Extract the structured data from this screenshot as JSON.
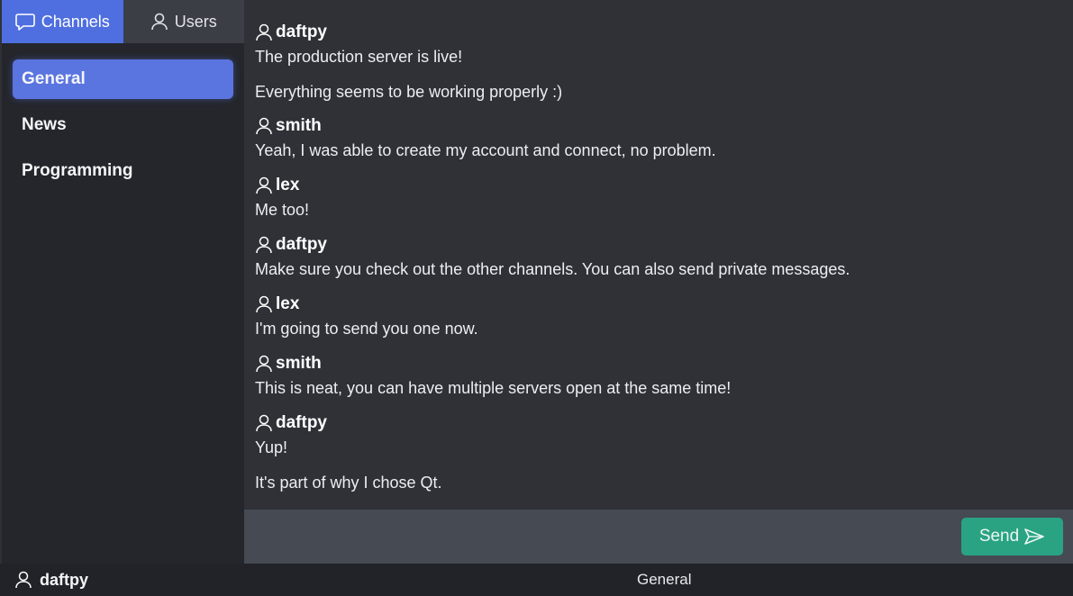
{
  "tabs": {
    "channels_label": "Channels",
    "users_label": "Users"
  },
  "channels": [
    {
      "label": "General",
      "selected": true
    },
    {
      "label": "News",
      "selected": false
    },
    {
      "label": "Programming",
      "selected": false
    }
  ],
  "messages": [
    {
      "author": "daftpy",
      "lines": [
        "The production server is live!",
        "Everything seems to be working properly :)"
      ]
    },
    {
      "author": "smith",
      "lines": [
        "Yeah, I was able to create my account and connect, no problem."
      ]
    },
    {
      "author": "lex",
      "lines": [
        "Me too!"
      ]
    },
    {
      "author": "daftpy",
      "lines": [
        "Make sure you check out the other channels. You can also send private messages."
      ]
    },
    {
      "author": "lex",
      "lines": [
        "I'm going to send you one now."
      ]
    },
    {
      "author": "smith",
      "lines": [
        "This is neat, you can have multiple servers open at the same time!"
      ]
    },
    {
      "author": "daftpy",
      "lines": [
        "Yup!",
        "It's part of why I chose Qt."
      ]
    }
  ],
  "composer": {
    "value": "",
    "send_label": "Send"
  },
  "status": {
    "username": "daftpy",
    "current_channel": "General"
  },
  "icons": {
    "channels_tab": "chat-bubble-icon",
    "users_tab": "user-icon",
    "author": "user-icon",
    "send": "send-arrow-icon"
  },
  "colors": {
    "accent": "#4f6fe0",
    "send_button": "#2aa383",
    "background": "#2f3137",
    "sidebar": "#24262b"
  }
}
